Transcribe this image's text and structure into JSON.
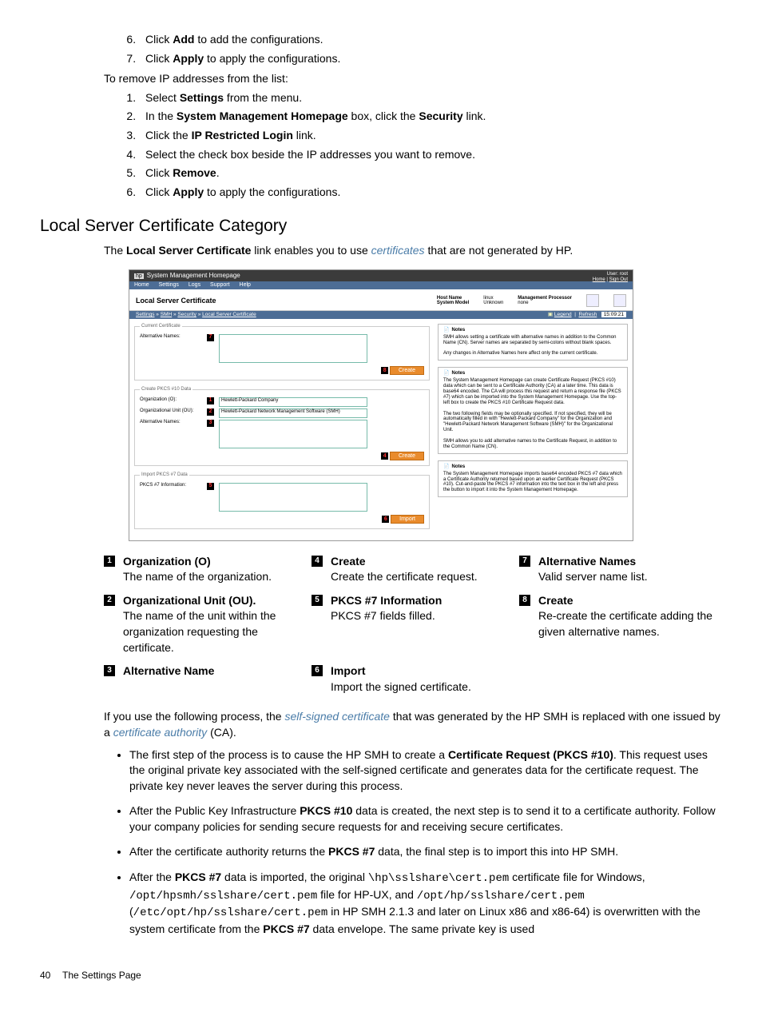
{
  "top_list_a": [
    {
      "n": "6.",
      "pre": "Click ",
      "bold": "Add",
      "post": " to add the configurations."
    },
    {
      "n": "7.",
      "pre": "Click ",
      "bold": "Apply",
      "post": " to apply the configurations."
    }
  ],
  "remove_intro": "To remove IP addresses from the list:",
  "top_list_b": [
    {
      "n": "1.",
      "pre": "Select ",
      "bold": "Settings",
      "post": " from the menu."
    },
    {
      "n": "2.",
      "pre": "In the ",
      "bold": "System Management Homepage",
      "post": " box, click the ",
      "bold2": "Security",
      "post2": " link."
    },
    {
      "n": "3.",
      "pre": "Click the ",
      "bold": "IP Restricted Login",
      "post": " link."
    },
    {
      "n": "4.",
      "pre": "Select the check box beside the IP addresses you want to remove.",
      "bold": "",
      "post": ""
    },
    {
      "n": "5.",
      "pre": "Click ",
      "bold": "Remove",
      "post": "."
    },
    {
      "n": "6.",
      "pre": "Click ",
      "bold": "Apply",
      "post": " to apply the configurations."
    }
  ],
  "section_title": "Local Server Certificate Category",
  "section_intro_pre": "The ",
  "section_intro_bold": "Local Server Certificate",
  "section_intro_mid": " link enables you to use ",
  "section_intro_it": "certificates",
  "section_intro_post": " that are not generated by HP.",
  "ss": {
    "app_title": "System Management Homepage",
    "user_line": "User: root",
    "links": [
      "Home",
      "Sign Out"
    ],
    "tabs": [
      "Home",
      "Settings",
      "Logs",
      "Support",
      "Help"
    ],
    "page_title": "Local Server Certificate",
    "host": {
      "hn_l": "Host Name",
      "hn_v": "linux",
      "sm_l": "System Model",
      "sm_v": "Unknown",
      "mp_l": "Management Processor",
      "mp_v": "none"
    },
    "breadcrumb": [
      "Settings",
      "SMH",
      "Security",
      "Local Server Certificate"
    ],
    "legend": "Legend",
    "refresh": "Refresh",
    "time": "15:09:21",
    "fs1": {
      "title": "Current Certificate",
      "l1": "Alternative Names:",
      "btn": "Create"
    },
    "fs2": {
      "title": "Create PKCS #10 Data",
      "o_l": "Organization (O):",
      "o_v": "Hewlett-Packard Company",
      "ou_l": "Organizational Unit (OU):",
      "ou_v": "Hewlett-Packard Network Management Software (SMH)",
      "an_l": "Alternative Names:",
      "btn": "Create"
    },
    "fs3": {
      "title": "Import PKCS #7 Data",
      "l1": "PKCS #7 Information:",
      "btn": "Import"
    },
    "notes_title": "Notes",
    "n1a": "SMH allows setting a certificate with alternative names in addition to the Common Name (CN). Server names are separated by semi-colons without blank spaces.",
    "n1b": "Any changes in Alternative Names here affect only the current certificate.",
    "n2a": "The System Management Homepage can create Certificate Request (PKCS #10) data which can be sent to a Certificate Authority (CA) at a later time. This data is base64 encoded. The CA will process this request and return a response file (PKCS #7) which can be imported into the System Management Homepage. Use the top-left box to create the PKCS #10 Certificate Request data.",
    "n2b": "The two following fields may be optionally specified. If not specified, they will be automatically filled in with \"Hewlett-Packard Company\" for the Organization and \"Hewlett-Packard Network Management Software (SMH)\" for the Organizational Unit.",
    "n2c": "SMH allows you to add alternative names to the Certificate Request, in addition to the Common Name (CN).",
    "n3a": "The System Management Homepage imports base64 encoded PKCS #7 data which a Certificate Authority returned based upon an earlier Certificate Request (PKCS #10). Cut-and-paste the PKCS #7 information into the text box in the left and press the button to import it into the System Management Homepage."
  },
  "callouts": [
    {
      "n": "1",
      "t": "Organization (O)",
      "b": "The name of the organization."
    },
    {
      "n": "2",
      "t": "Organizational Unit (OU).",
      "b": "The name of the unit within the organization requesting the certificate."
    },
    {
      "n": "3",
      "t": "Alternative Name",
      "b": ""
    },
    {
      "n": "4",
      "t": "Create",
      "b": "Create the certificate request."
    },
    {
      "n": "5",
      "t": "PKCS #7 Information",
      "b": "PKCS #7 fields filled."
    },
    {
      "n": "6",
      "t": "Import",
      "b": "Import the signed certificate."
    },
    {
      "n": "7",
      "t": "Alternative Names",
      "b": "Valid server name list."
    },
    {
      "n": "8",
      "t": "Create",
      "b": "Re-create the certificate adding the given alternative names."
    }
  ],
  "process_intro_pre": "If you use the following process, the ",
  "process_intro_it1": "self-signed certificate",
  "process_intro_mid": " that was generated by the HP SMH is replaced with one issued by a ",
  "process_intro_it2": "certificate authority",
  "process_intro_post": " (CA).",
  "bullets": [
    {
      "parts": [
        {
          "t": "The first step of the process is to cause the HP SMH to create a "
        },
        {
          "b": "Certificate Request (PKCS #10)"
        },
        {
          "t": ". This request uses the original private key associated with the self-signed certificate and generates data for the certificate request. The private key never leaves the server during this process."
        }
      ]
    },
    {
      "parts": [
        {
          "t": "After the Public Key Infrastructure "
        },
        {
          "b": "PKCS #10"
        },
        {
          "t": " data is created, the next step is to send it to a certificate authority. Follow your company policies for sending secure requests for and receiving secure certificates."
        }
      ]
    },
    {
      "parts": [
        {
          "t": "After the certificate authority returns the "
        },
        {
          "b": "PKCS #7"
        },
        {
          "t": " data, the final step is to import this into HP SMH."
        }
      ]
    },
    {
      "parts": [
        {
          "t": "After the "
        },
        {
          "b": "PKCS #7"
        },
        {
          "t": " data is imported, the original "
        },
        {
          "m": "\\hp\\sslshare\\cert.pem"
        },
        {
          "t": " certificate file for Windows, "
        },
        {
          "m": "/opt/hpsmh/sslshare/cert.pem"
        },
        {
          "t": " file for HP-UX, and "
        },
        {
          "m": "/opt/hp/sslshare/cert.pem"
        },
        {
          "t": " ("
        },
        {
          "m": "/etc/opt/hp/sslshare/cert.pem"
        },
        {
          "t": " in HP SMH 2.1.3 and later on Linux x86 and x86-64) is overwritten with the system certificate from the "
        },
        {
          "b": "PKCS #7"
        },
        {
          "t": " data envelope. The same private key is used"
        }
      ]
    }
  ],
  "footer_page": "40",
  "footer_title": "The Settings Page"
}
